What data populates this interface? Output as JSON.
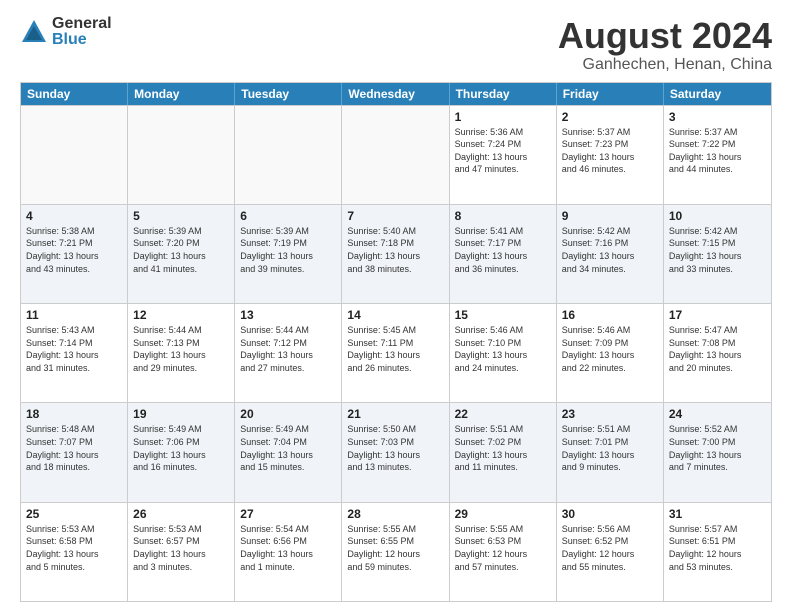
{
  "logo": {
    "general": "General",
    "blue": "Blue"
  },
  "title": {
    "month": "August 2024",
    "location": "Ganhechen, Henan, China"
  },
  "header_days": [
    "Sunday",
    "Monday",
    "Tuesday",
    "Wednesday",
    "Thursday",
    "Friday",
    "Saturday"
  ],
  "rows": [
    [
      {
        "day": "",
        "info": ""
      },
      {
        "day": "",
        "info": ""
      },
      {
        "day": "",
        "info": ""
      },
      {
        "day": "",
        "info": ""
      },
      {
        "day": "1",
        "info": "Sunrise: 5:36 AM\nSunset: 7:24 PM\nDaylight: 13 hours\nand 47 minutes."
      },
      {
        "day": "2",
        "info": "Sunrise: 5:37 AM\nSunset: 7:23 PM\nDaylight: 13 hours\nand 46 minutes."
      },
      {
        "day": "3",
        "info": "Sunrise: 5:37 AM\nSunset: 7:22 PM\nDaylight: 13 hours\nand 44 minutes."
      }
    ],
    [
      {
        "day": "4",
        "info": "Sunrise: 5:38 AM\nSunset: 7:21 PM\nDaylight: 13 hours\nand 43 minutes."
      },
      {
        "day": "5",
        "info": "Sunrise: 5:39 AM\nSunset: 7:20 PM\nDaylight: 13 hours\nand 41 minutes."
      },
      {
        "day": "6",
        "info": "Sunrise: 5:39 AM\nSunset: 7:19 PM\nDaylight: 13 hours\nand 39 minutes."
      },
      {
        "day": "7",
        "info": "Sunrise: 5:40 AM\nSunset: 7:18 PM\nDaylight: 13 hours\nand 38 minutes."
      },
      {
        "day": "8",
        "info": "Sunrise: 5:41 AM\nSunset: 7:17 PM\nDaylight: 13 hours\nand 36 minutes."
      },
      {
        "day": "9",
        "info": "Sunrise: 5:42 AM\nSunset: 7:16 PM\nDaylight: 13 hours\nand 34 minutes."
      },
      {
        "day": "10",
        "info": "Sunrise: 5:42 AM\nSunset: 7:15 PM\nDaylight: 13 hours\nand 33 minutes."
      }
    ],
    [
      {
        "day": "11",
        "info": "Sunrise: 5:43 AM\nSunset: 7:14 PM\nDaylight: 13 hours\nand 31 minutes."
      },
      {
        "day": "12",
        "info": "Sunrise: 5:44 AM\nSunset: 7:13 PM\nDaylight: 13 hours\nand 29 minutes."
      },
      {
        "day": "13",
        "info": "Sunrise: 5:44 AM\nSunset: 7:12 PM\nDaylight: 13 hours\nand 27 minutes."
      },
      {
        "day": "14",
        "info": "Sunrise: 5:45 AM\nSunset: 7:11 PM\nDaylight: 13 hours\nand 26 minutes."
      },
      {
        "day": "15",
        "info": "Sunrise: 5:46 AM\nSunset: 7:10 PM\nDaylight: 13 hours\nand 24 minutes."
      },
      {
        "day": "16",
        "info": "Sunrise: 5:46 AM\nSunset: 7:09 PM\nDaylight: 13 hours\nand 22 minutes."
      },
      {
        "day": "17",
        "info": "Sunrise: 5:47 AM\nSunset: 7:08 PM\nDaylight: 13 hours\nand 20 minutes."
      }
    ],
    [
      {
        "day": "18",
        "info": "Sunrise: 5:48 AM\nSunset: 7:07 PM\nDaylight: 13 hours\nand 18 minutes."
      },
      {
        "day": "19",
        "info": "Sunrise: 5:49 AM\nSunset: 7:06 PM\nDaylight: 13 hours\nand 16 minutes."
      },
      {
        "day": "20",
        "info": "Sunrise: 5:49 AM\nSunset: 7:04 PM\nDaylight: 13 hours\nand 15 minutes."
      },
      {
        "day": "21",
        "info": "Sunrise: 5:50 AM\nSunset: 7:03 PM\nDaylight: 13 hours\nand 13 minutes."
      },
      {
        "day": "22",
        "info": "Sunrise: 5:51 AM\nSunset: 7:02 PM\nDaylight: 13 hours\nand 11 minutes."
      },
      {
        "day": "23",
        "info": "Sunrise: 5:51 AM\nSunset: 7:01 PM\nDaylight: 13 hours\nand 9 minutes."
      },
      {
        "day": "24",
        "info": "Sunrise: 5:52 AM\nSunset: 7:00 PM\nDaylight: 13 hours\nand 7 minutes."
      }
    ],
    [
      {
        "day": "25",
        "info": "Sunrise: 5:53 AM\nSunset: 6:58 PM\nDaylight: 13 hours\nand 5 minutes."
      },
      {
        "day": "26",
        "info": "Sunrise: 5:53 AM\nSunset: 6:57 PM\nDaylight: 13 hours\nand 3 minutes."
      },
      {
        "day": "27",
        "info": "Sunrise: 5:54 AM\nSunset: 6:56 PM\nDaylight: 13 hours\nand 1 minute."
      },
      {
        "day": "28",
        "info": "Sunrise: 5:55 AM\nSunset: 6:55 PM\nDaylight: 12 hours\nand 59 minutes."
      },
      {
        "day": "29",
        "info": "Sunrise: 5:55 AM\nSunset: 6:53 PM\nDaylight: 12 hours\nand 57 minutes."
      },
      {
        "day": "30",
        "info": "Sunrise: 5:56 AM\nSunset: 6:52 PM\nDaylight: 12 hours\nand 55 minutes."
      },
      {
        "day": "31",
        "info": "Sunrise: 5:57 AM\nSunset: 6:51 PM\nDaylight: 12 hours\nand 53 minutes."
      }
    ]
  ]
}
